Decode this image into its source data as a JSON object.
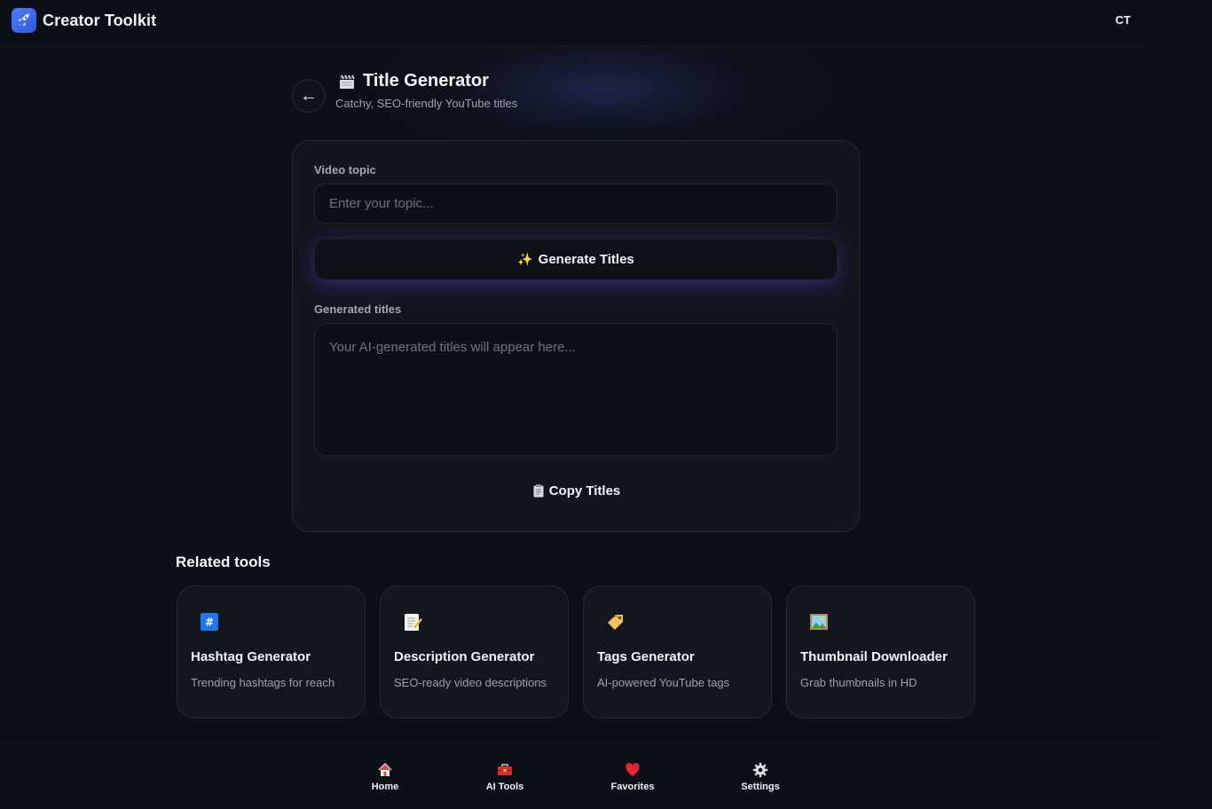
{
  "header": {
    "brand_name": "Creator Toolkit",
    "user_initials": "CT"
  },
  "page": {
    "title": "Title Generator",
    "subtitle": "Catchy, SEO-friendly YouTube titles"
  },
  "form": {
    "topic_label": "Video topic",
    "topic_placeholder": "Enter your topic...",
    "topic_value": "",
    "generate_label": "Generate Titles",
    "output_label": "Generated titles",
    "output_placeholder": "Your AI-generated titles will appear here...",
    "copy_label": "Copy Titles"
  },
  "related": {
    "heading": "Related tools",
    "tools": [
      {
        "name": "Hashtag Generator",
        "desc": "Trending hashtags for reach",
        "icon": "hashtag-icon"
      },
      {
        "name": "Description Generator",
        "desc": "SEO-ready video descriptions",
        "icon": "memo-icon"
      },
      {
        "name": "Tags Generator",
        "desc": "AI-powered YouTube tags",
        "icon": "tag-icon"
      },
      {
        "name": "Thumbnail Downloader",
        "desc": "Grab thumbnails in HD",
        "icon": "picture-icon"
      }
    ]
  },
  "nav": {
    "items": [
      {
        "label": "Home",
        "icon": "home-icon"
      },
      {
        "label": "AI Tools",
        "icon": "toolbox-icon"
      },
      {
        "label": "Favorites",
        "icon": "heart-icon"
      },
      {
        "label": "Settings",
        "icon": "gear-icon"
      }
    ]
  },
  "colors": {
    "background": "#0b0f16",
    "card": "#11161e",
    "brand_accent": "#4f7dff",
    "button_glow": "#5c46dc"
  }
}
